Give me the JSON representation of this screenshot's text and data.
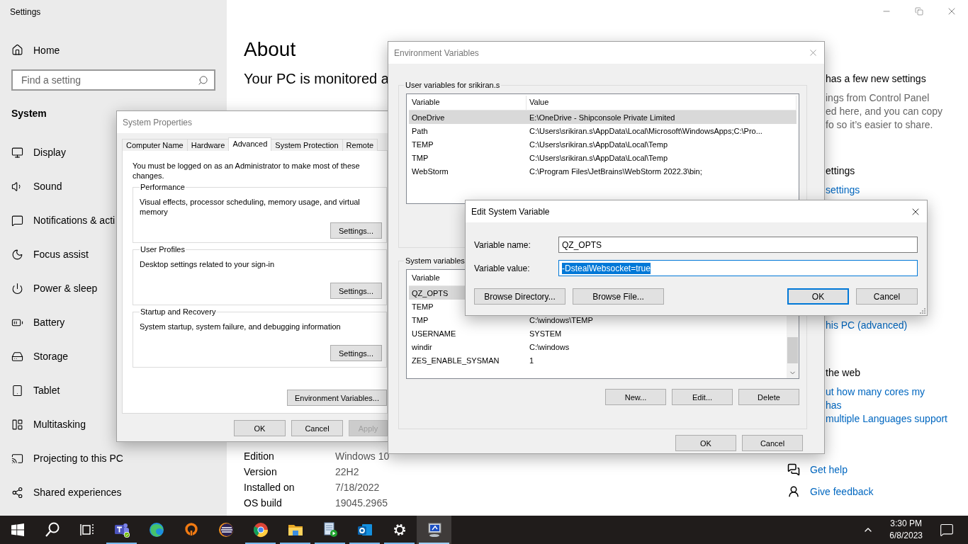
{
  "settings": {
    "title": "Settings",
    "home": "Home",
    "search": {
      "placeholder": "Find a setting"
    },
    "section": "System",
    "nav": [
      {
        "kind": "display",
        "label": "Display"
      },
      {
        "kind": "sound",
        "label": "Sound"
      },
      {
        "kind": "notifications",
        "label": "Notifications & acti"
      },
      {
        "kind": "focus",
        "label": "Focus assist"
      },
      {
        "kind": "power",
        "label": "Power & sleep"
      },
      {
        "kind": "battery",
        "label": "Battery"
      },
      {
        "kind": "storage",
        "label": "Storage"
      },
      {
        "kind": "tablet",
        "label": "Tablet"
      },
      {
        "kind": "multitasking",
        "label": "Multitasking"
      },
      {
        "kind": "projecting",
        "label": "Projecting to this PC"
      },
      {
        "kind": "shared",
        "label": "Shared experiences"
      }
    ],
    "about": {
      "title": "About",
      "subtitle": "Your PC is monitored a",
      "specs": [
        {
          "label": "Edition",
          "value": "Windows 10"
        },
        {
          "label": "Version",
          "value": "22H2"
        },
        {
          "label": "Installed on",
          "value": "7/18/2022"
        },
        {
          "label": "OS build",
          "value": "19045.2965"
        }
      ]
    },
    "related": [
      {
        "lines": [
          {
            "kind": "heading",
            "text": "has a few new settings"
          },
          {
            "kind": "note",
            "text": "ings from Control Panel"
          },
          {
            "kind": "note",
            "text": "ed here, and you can copy"
          },
          {
            "kind": "note",
            "text": "fo so it’s easier to share."
          }
        ]
      },
      {
        "lines": [
          {
            "kind": "heading",
            "text": "ettings"
          },
          {
            "kind": "link",
            "text": "settings"
          }
        ]
      },
      {
        "lines": [
          {
            "kind": "link",
            "text": "his PC (advanced)"
          }
        ]
      },
      {
        "lines": [
          {
            "kind": "heading",
            "text": "the web"
          },
          {
            "kind": "link",
            "text": "ut how many cores my"
          },
          {
            "kind": "link",
            "text": "has"
          },
          {
            "kind": "link",
            "text": "multiple Languages support"
          }
        ]
      }
    ],
    "help": [
      {
        "kind": "help",
        "label": "Get help"
      },
      {
        "kind": "feedback",
        "label": "Give feedback"
      }
    ]
  },
  "system_properties": {
    "title": "System Properties",
    "tabs": [
      {
        "label": "Computer Name",
        "selected": false
      },
      {
        "label": "Hardware",
        "selected": false
      },
      {
        "label": "Advanced",
        "selected": true
      },
      {
        "label": "System Protection",
        "selected": false
      },
      {
        "label": "Remote",
        "selected": false
      }
    ],
    "notice": "You must be logged on as an Administrator to make most of these changes.",
    "groups": [
      {
        "title": "Performance",
        "description": "Visual effects, processor scheduling, memory usage, and virtual memory",
        "button": "Settings..."
      },
      {
        "title": "User Profiles",
        "description": "Desktop settings related to your sign-in",
        "button": "Settings..."
      },
      {
        "title": "Startup and Recovery",
        "description": "System startup, system failure, and debugging information",
        "button": "Settings..."
      }
    ],
    "env_button": "Environment Variables...",
    "buttons": [
      {
        "label": "OK",
        "disabled": false
      },
      {
        "label": "Cancel",
        "disabled": false
      },
      {
        "label": "Apply",
        "disabled": true
      }
    ]
  },
  "environment_variables": {
    "title": "Environment Variables",
    "user_group": "User variables for srikiran.s",
    "user_columns": [
      "Variable",
      "Value"
    ],
    "user_rows": [
      {
        "variable": "OneDrive",
        "value": "E:\\OneDrive - Shipconsole Private Limited",
        "selected": true
      },
      {
        "variable": "Path",
        "value": "C:\\Users\\srikiran.s\\AppData\\Local\\Microsoft\\WindowsApps;C:\\Pro...",
        "selected": false
      },
      {
        "variable": "TEMP",
        "value": "C:\\Users\\srikiran.s\\AppData\\Local\\Temp",
        "selected": false
      },
      {
        "variable": "TMP",
        "value": "C:\\Users\\srikiran.s\\AppData\\Local\\Temp",
        "selected": false
      },
      {
        "variable": "WebStorm",
        "value": "C:\\Program Files\\JetBrains\\WebStorm 2022.3\\bin;",
        "selected": false
      }
    ],
    "system_group": "System variables",
    "system_columns": [
      "Variable"
    ],
    "system_rows": [
      {
        "variable": "QZ_OPTS",
        "selected": true
      },
      {
        "variable": "TEMP",
        "selected": false
      },
      {
        "variable": "TMP",
        "value": "C:\\windows\\TEMP",
        "selected": false
      },
      {
        "variable": "USERNAME",
        "value": "SYSTEM",
        "selected": false
      },
      {
        "variable": "windir",
        "value": "C:\\windows",
        "selected": false
      },
      {
        "variable": "ZES_ENABLE_SYSMAN",
        "value": "1",
        "selected": false
      }
    ],
    "system_buttons": [
      "New...",
      "Edit...",
      "Delete"
    ],
    "buttons": [
      "OK",
      "Cancel"
    ]
  },
  "edit_dialog": {
    "title": "Edit System Variable",
    "name_label": "Variable name:",
    "name_value": "QZ_OPTS",
    "value_label": "Variable value:",
    "value_value": "-DstealWebsocket=true",
    "value_selected": true,
    "buttons": [
      {
        "label": "Browse Directory...",
        "default": false
      },
      {
        "label": "Browse File...",
        "default": false
      },
      {
        "label": "OK",
        "default": true
      },
      {
        "label": "Cancel",
        "default": false
      }
    ]
  },
  "taskbar": {
    "apps": [
      {
        "kind": "start",
        "running": false,
        "active": false
      },
      {
        "kind": "search",
        "running": false,
        "active": false
      },
      {
        "kind": "taskview",
        "running": false,
        "active": false
      },
      {
        "kind": "teams",
        "running": true,
        "active": false
      },
      {
        "kind": "edge",
        "running": false,
        "active": false
      },
      {
        "kind": "vpn",
        "running": false,
        "active": false
      },
      {
        "kind": "eclipse",
        "running": false,
        "active": false
      },
      {
        "kind": "chrome",
        "running": true,
        "active": false
      },
      {
        "kind": "explorer",
        "running": true,
        "active": false
      },
      {
        "kind": "player",
        "running": true,
        "active": false
      },
      {
        "kind": "outlook",
        "running": true,
        "active": false
      },
      {
        "kind": "settings",
        "running": true,
        "active": false
      },
      {
        "kind": "sysprops",
        "running": true,
        "active": true
      }
    ],
    "time": "3:30 PM",
    "date": "6/8/2023"
  }
}
